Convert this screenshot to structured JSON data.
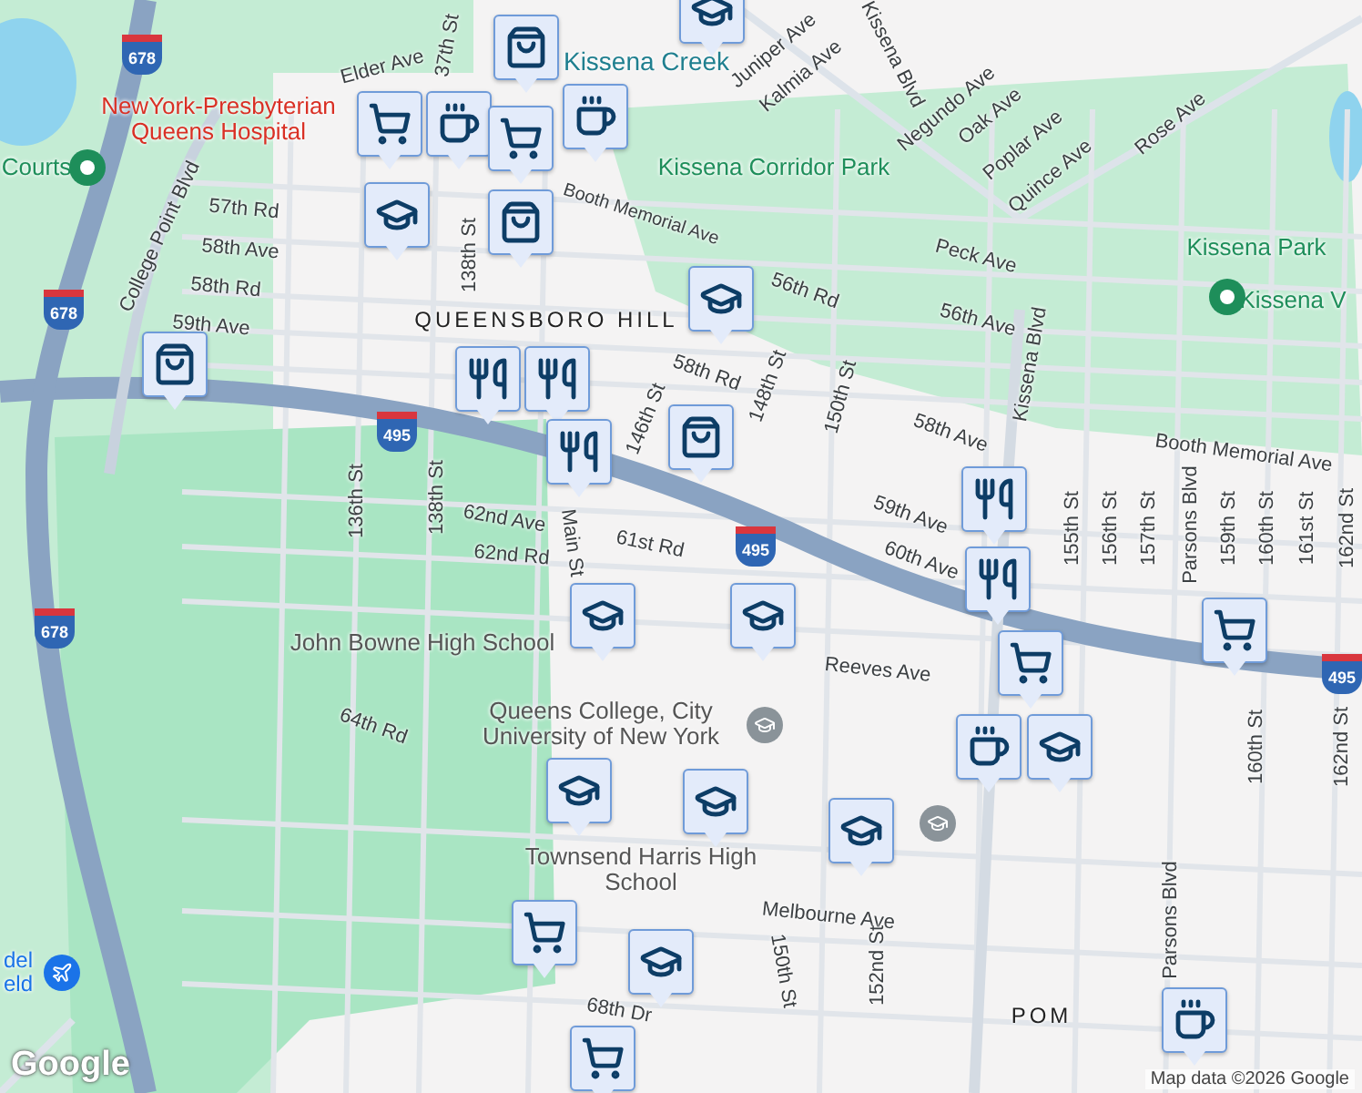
{
  "map": {
    "labels": [
      {
        "text": "Elder Ave",
        "kind": "street"
      },
      {
        "text": "37th St",
        "kind": "street"
      },
      {
        "text": "College Point Blvd",
        "kind": "street"
      },
      {
        "text": "57th Rd",
        "kind": "street"
      },
      {
        "text": "58th Ave",
        "kind": "street"
      },
      {
        "text": "58th Rd",
        "kind": "street"
      },
      {
        "text": "59th Ave",
        "kind": "street"
      },
      {
        "text": "Booth Memorial Ave",
        "kind": "street"
      },
      {
        "text": "138th St",
        "kind": "street"
      },
      {
        "text": "QUEENSBORO HILL",
        "kind": "neighborhood"
      },
      {
        "text": "58th Rd",
        "kind": "street"
      },
      {
        "text": "146th St",
        "kind": "street"
      },
      {
        "text": "148th St",
        "kind": "street"
      },
      {
        "text": "150th St",
        "kind": "street"
      },
      {
        "text": "56th Rd",
        "kind": "street"
      },
      {
        "text": "Peck Ave",
        "kind": "street"
      },
      {
        "text": "56th Ave",
        "kind": "street"
      },
      {
        "text": "Kissena Blvd",
        "kind": "street"
      },
      {
        "text": "58th Ave",
        "kind": "street"
      },
      {
        "text": "59th Ave",
        "kind": "street"
      },
      {
        "text": "60th Ave",
        "kind": "street"
      },
      {
        "text": "Booth Memorial Ave",
        "kind": "street"
      },
      {
        "text": "155th St",
        "kind": "street"
      },
      {
        "text": "156th St",
        "kind": "street"
      },
      {
        "text": "157th St",
        "kind": "street"
      },
      {
        "text": "Parsons Blvd",
        "kind": "street"
      },
      {
        "text": "159th St",
        "kind": "street"
      },
      {
        "text": "160th St",
        "kind": "street"
      },
      {
        "text": "161st St",
        "kind": "street"
      },
      {
        "text": "162nd St",
        "kind": "street"
      },
      {
        "text": "Juniper Ave",
        "kind": "street"
      },
      {
        "text": "Kalmia Ave",
        "kind": "street"
      },
      {
        "text": "Kissena Blvd",
        "kind": "street"
      },
      {
        "text": "Negundo Ave",
        "kind": "street"
      },
      {
        "text": "Oak Ave",
        "kind": "street"
      },
      {
        "text": "Poplar Ave",
        "kind": "street"
      },
      {
        "text": "Quince Ave",
        "kind": "street"
      },
      {
        "text": "Rose Ave",
        "kind": "street"
      },
      {
        "text": "136th St",
        "kind": "street"
      },
      {
        "text": "138th St",
        "kind": "street"
      },
      {
        "text": "62nd Ave",
        "kind": "street"
      },
      {
        "text": "Main St",
        "kind": "street"
      },
      {
        "text": "62nd Rd",
        "kind": "street"
      },
      {
        "text": "61st Rd",
        "kind": "street"
      },
      {
        "text": "64th Rd",
        "kind": "street"
      },
      {
        "text": "Reeves Ave",
        "kind": "street"
      },
      {
        "text": "Melbourne Ave",
        "kind": "street"
      },
      {
        "text": "150th St",
        "kind": "street"
      },
      {
        "text": "152nd St",
        "kind": "street"
      },
      {
        "text": "Parsons Blvd",
        "kind": "street"
      },
      {
        "text": "160th St",
        "kind": "street"
      },
      {
        "text": "162nd St",
        "kind": "street"
      },
      {
        "text": "68th Dr",
        "kind": "street"
      },
      {
        "text": "Kissena Creek",
        "kind": "water"
      },
      {
        "text": "NewYork-Presbyterian Queens Hospital",
        "kind": "hospital"
      },
      {
        "text": "Courts",
        "kind": "park"
      },
      {
        "text": "Kissena Corridor Park",
        "kind": "park"
      },
      {
        "text": "Kissena Park",
        "kind": "park"
      },
      {
        "text": "Kissena V",
        "kind": "park"
      },
      {
        "text": "John Bowne High School",
        "kind": "place"
      },
      {
        "text": "Queens College, City University of New York",
        "kind": "place"
      },
      {
        "text": "Townsend Harris High School",
        "kind": "place"
      },
      {
        "text": "del eld",
        "kind": "airport"
      },
      {
        "text": "POM",
        "kind": "neighborhood"
      }
    ],
    "shields": [
      {
        "number": "678"
      },
      {
        "number": "678"
      },
      {
        "number": "678"
      },
      {
        "number": "495"
      },
      {
        "number": "495"
      },
      {
        "number": "495"
      }
    ],
    "markers": [
      {
        "kind": "shop"
      },
      {
        "kind": "grocery"
      },
      {
        "kind": "coffee"
      },
      {
        "kind": "coffee"
      },
      {
        "kind": "grocery"
      },
      {
        "kind": "shop"
      },
      {
        "kind": "school"
      },
      {
        "kind": "school"
      },
      {
        "kind": "restaurant"
      },
      {
        "kind": "restaurant"
      },
      {
        "kind": "restaurant"
      },
      {
        "kind": "shop"
      },
      {
        "kind": "shop"
      },
      {
        "kind": "restaurant"
      },
      {
        "kind": "restaurant"
      },
      {
        "kind": "grocery"
      },
      {
        "kind": "grocery"
      },
      {
        "kind": "school"
      },
      {
        "kind": "school"
      },
      {
        "kind": "coffee"
      },
      {
        "kind": "school"
      },
      {
        "kind": "school"
      },
      {
        "kind": "school"
      },
      {
        "kind": "school"
      },
      {
        "kind": "grocery"
      },
      {
        "kind": "school"
      },
      {
        "kind": "coffee"
      },
      {
        "kind": "grocery"
      },
      {
        "kind": "school"
      }
    ],
    "attribution": "Map data ©2026 Google",
    "logo": "Google"
  }
}
